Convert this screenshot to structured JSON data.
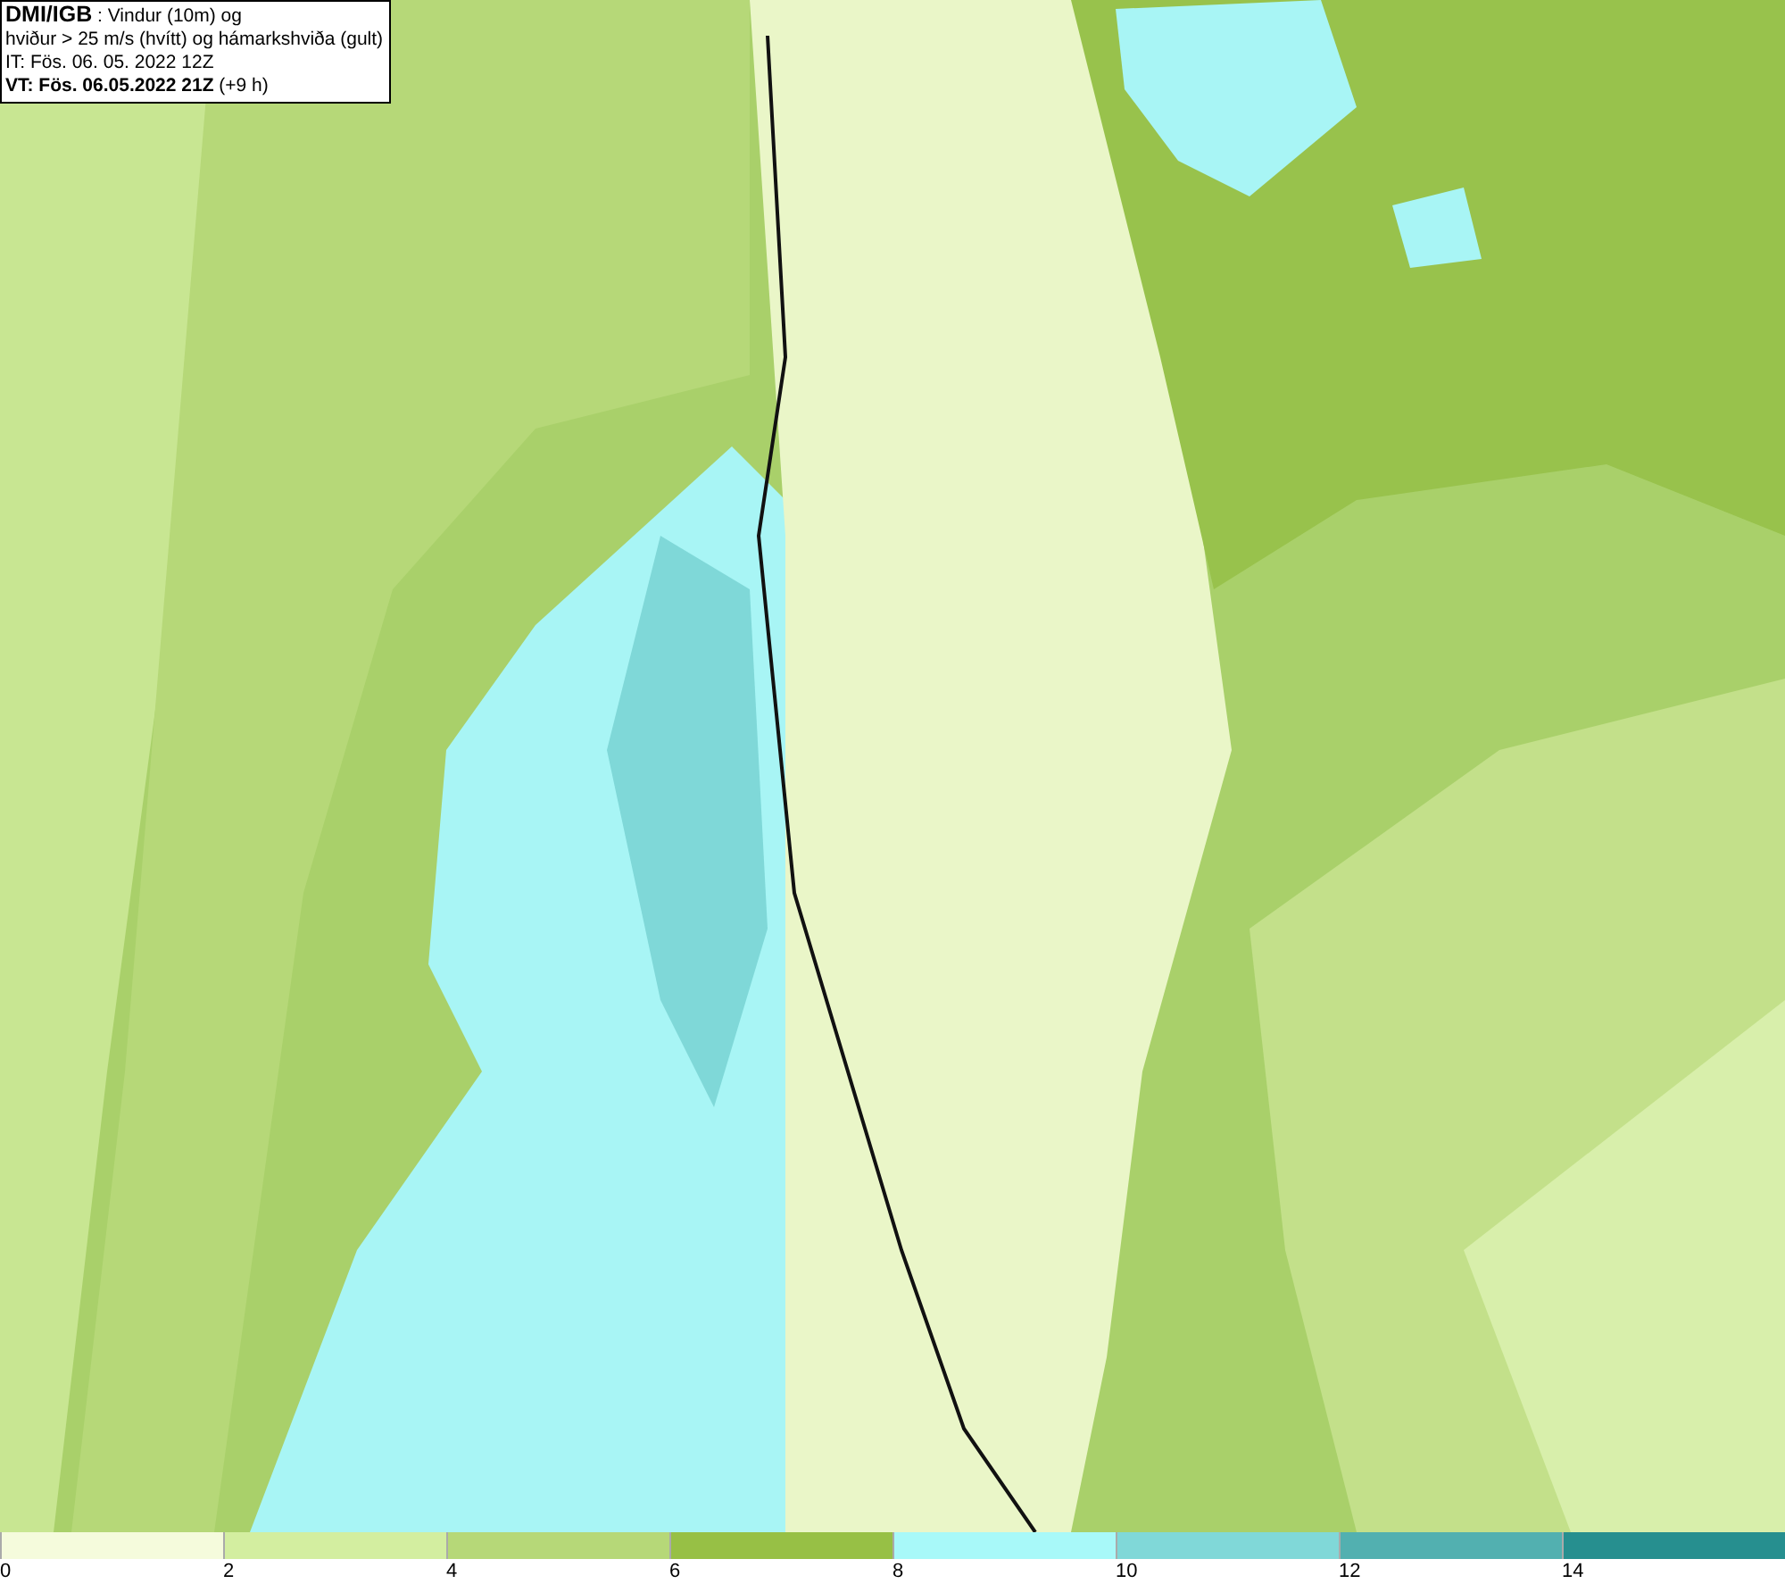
{
  "info_box": {
    "source": "DMI/IGB",
    "title": ": Vindur (10m) og",
    "subtitle": "hviður > 25 m/s (hvítt) og hámarkshviða (gult)",
    "initial_time": "IT: Fös. 06. 05. 2022 12Z",
    "valid_time": "VT: Fös. 06.05.2022 21Z",
    "lead_time": "(+9 h)"
  },
  "legend": [
    {
      "label": "0",
      "color": "#f5fbdc"
    },
    {
      "label": "2",
      "color": "#d3eea0"
    },
    {
      "label": "4",
      "color": "#b6d878"
    },
    {
      "label": "6",
      "color": "#97c045"
    },
    {
      "label": "8",
      "color": "#a8f9f9"
    },
    {
      "label": "10",
      "color": "#80d8d8"
    },
    {
      "label": "12",
      "color": "#52b0b0"
    },
    {
      "label": "14",
      "color": "#268f8f"
    }
  ]
}
